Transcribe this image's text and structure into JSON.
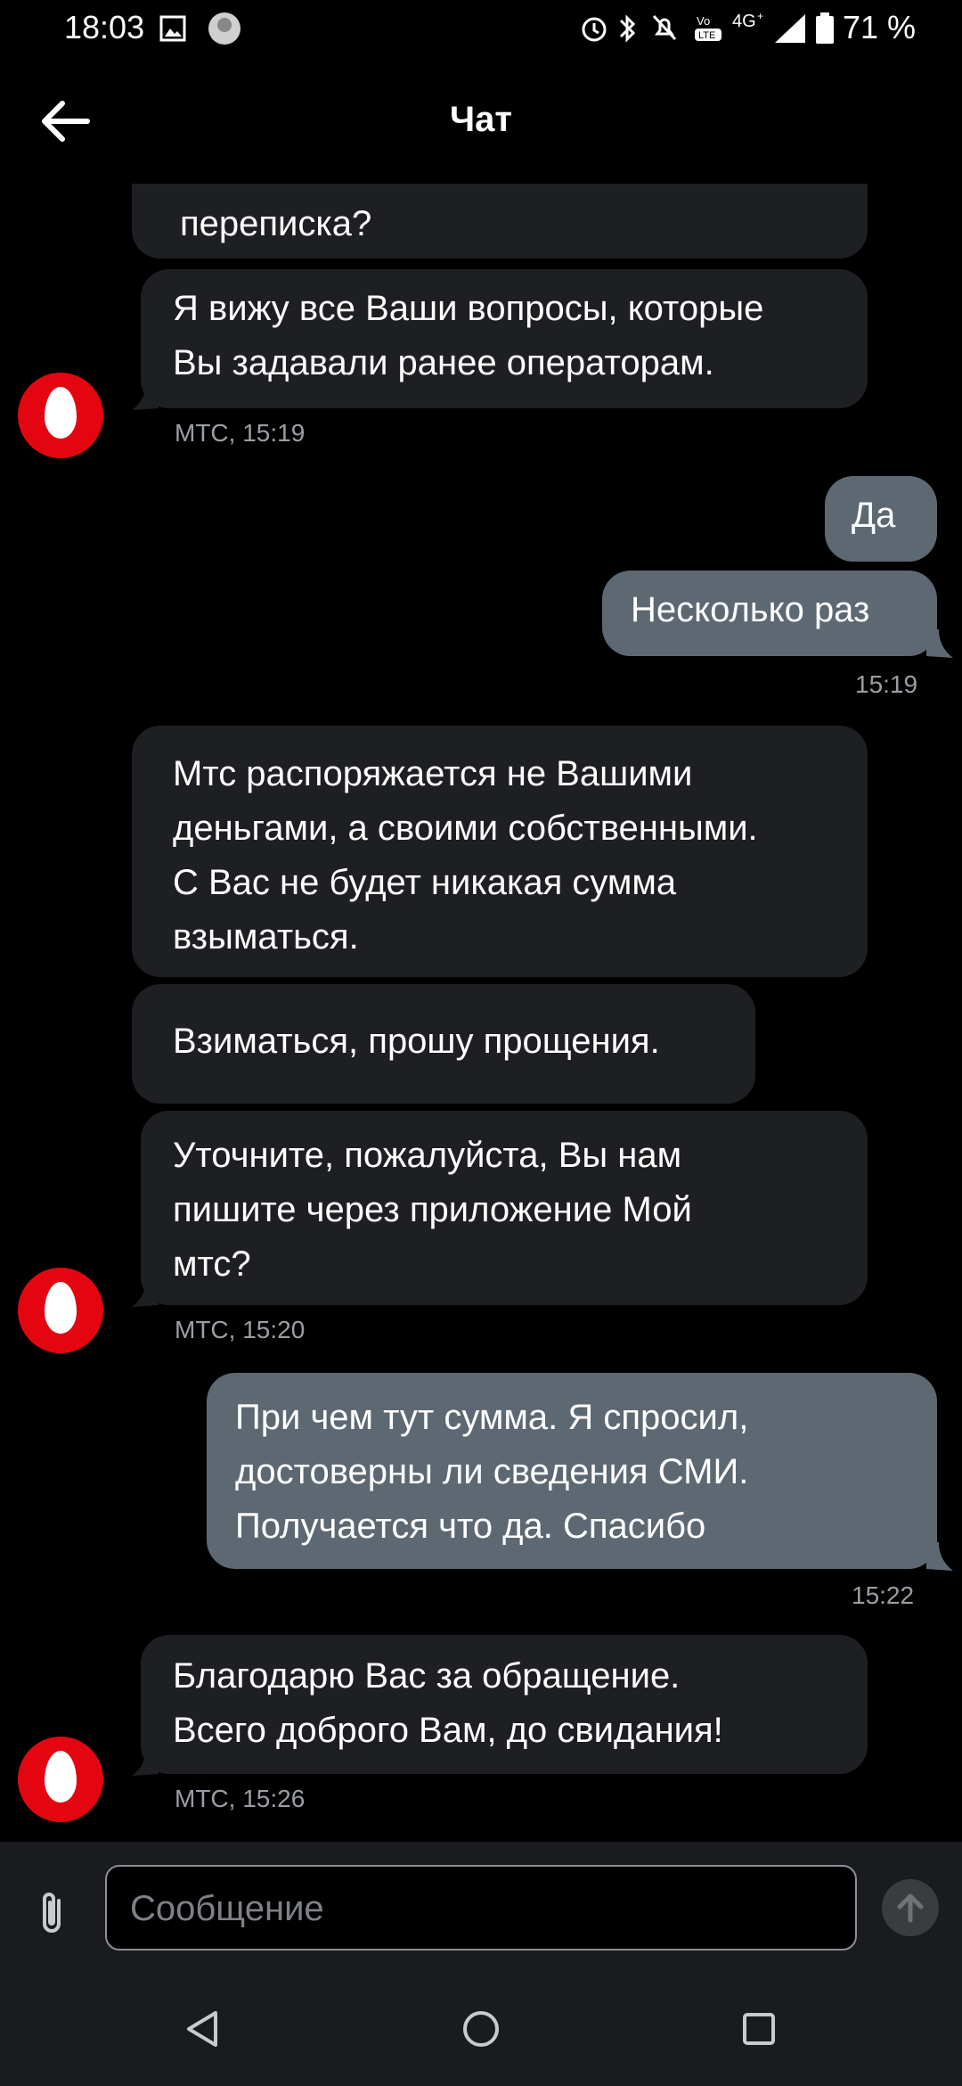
{
  "status_bar": {
    "time": "18:03",
    "battery": "71 %",
    "icons": [
      "image-icon",
      "avatar-icon",
      "alarm-icon",
      "bluetooth-icon",
      "dnd-icon",
      "volte-icon",
      "4g-icon",
      "signal-icon",
      "battery-icon"
    ]
  },
  "header": {
    "title": "Чат",
    "back_icon": "arrow-left-icon"
  },
  "messages": {
    "m0": {
      "lines": [
        "переписка?"
      ]
    },
    "m1": {
      "lines": [
        "Я вижу все Ваши вопросы, которые",
        "Вы задавали ранее операторам."
      ],
      "meta": "МТС, 15:19"
    },
    "m2": {
      "lines": [
        "Да"
      ]
    },
    "m3": {
      "lines": [
        "Несколько раз"
      ],
      "meta": "15:19"
    },
    "m4": {
      "lines": [
        "Мтс распоряжается не Вашими",
        "деньгами, а своими собственными.",
        "С Вас не будет никакая сумма",
        "взыматься."
      ]
    },
    "m5": {
      "lines": [
        "Взиматься, прошу прощения."
      ]
    },
    "m6": {
      "lines": [
        "Уточните, пожалуйста, Вы нам",
        "пишите через приложение Мой",
        "мтс?"
      ],
      "meta": "МТС, 15:20"
    },
    "m7": {
      "lines": [
        "При чем тут сумма. Я спросил,",
        "достоверны ли сведения СМИ.",
        "Получается что да. Спасибо"
      ],
      "meta": "15:22"
    },
    "m8": {
      "lines": [
        "Благодарю Вас за обращение.",
        "Всего доброго Вам, до свидания!"
      ],
      "meta": "МТС, 15:26"
    }
  },
  "input": {
    "placeholder": "Сообщение",
    "value": "",
    "attach_icon": "paperclip-icon",
    "send_icon": "arrow-up-icon"
  },
  "nav": {
    "icons": [
      "back-triangle-icon",
      "home-circle-icon",
      "recents-square-icon"
    ]
  },
  "colors": {
    "background": "#000000",
    "incoming_bubble": "#1e1f22",
    "outgoing_bubble": "#5d6872",
    "brand_red": "#e30611",
    "meta_text": "#9a9ea4"
  }
}
